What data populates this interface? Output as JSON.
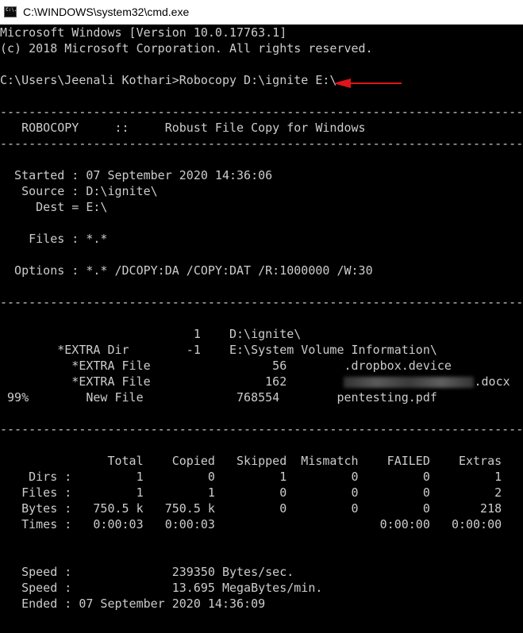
{
  "window": {
    "title": "C:\\WINDOWS\\system32\\cmd.exe",
    "icon": "cmd-icon",
    "icon_text": "C:\\."
  },
  "console": {
    "lines": [
      "Microsoft Windows [Version 10.0.17763.1]",
      "(c) 2018 Microsoft Corporation. All rights reserved.",
      "",
      "C:\\Users\\Jeenali Kothari>Robocopy D:\\ignite E:\\",
      "",
      "-------------------------------------------------------------------------------",
      "   ROBOCOPY     ::     Robust File Copy for Windows",
      "-------------------------------------------------------------------------------",
      "",
      "  Started : 07 September 2020 14:36:06",
      "   Source : D:\\ignite\\",
      "     Dest = E:\\",
      "",
      "    Files : *.*",
      "",
      "  Options : *.* /DCOPY:DA /COPY:DAT /R:1000000 /W:30",
      "",
      "-------------------------------------------------------------------------------",
      "",
      "                           1    D:\\ignite\\",
      "        *EXTRA Dir        -1    E:\\System Volume Information\\",
      "          *EXTRA File                 56        .dropbox.device",
      "          *EXTRA File                162        ",
      " 99%        New File             768554        pentesting.pdf",
      "",
      "-------------------------------------------------------------------------------",
      "",
      "               Total    Copied   Skipped  Mismatch    FAILED    Extras",
      "    Dirs :         1         0         1         0         0         1",
      "   Files :         1         1         0         0         0         2",
      "   Bytes :   750.5 k   750.5 k         0         0         0       218",
      "   Times :   0:00:03   0:00:03                       0:00:00   0:00:00",
      "",
      "",
      "   Speed :              239350 Bytes/sec.",
      "   Speed :              13.695 MegaBytes/min.",
      "   Ended : 07 September 2020 14:36:09"
    ],
    "redacted_suffix": ".docx",
    "redacted_text": "JEENALI_KOTHARI_CV",
    "annotation": "red-arrow-pointing-left",
    "colors": {
      "background": "#000000",
      "text": "#cccccc",
      "arrow": "#e0141b",
      "titlebar": "#ffffff"
    }
  }
}
